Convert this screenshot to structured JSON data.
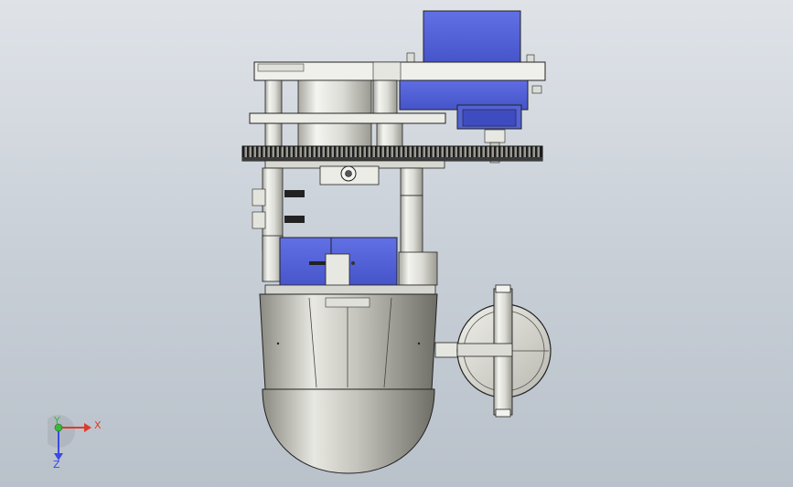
{
  "triad": {
    "x_label": "X",
    "y_label": "Y",
    "z_label": "Z"
  },
  "colors": {
    "background_top": "#dfe3e8",
    "background_bottom": "#b9c1ca",
    "motor_blue": "#5a68d8",
    "metal_light": "#eeeeea",
    "metal_mid": "#c9c9c1",
    "metal_dark": "#8d8d85",
    "gear_dark": "#2a2a2a",
    "axis_x": "#e03a2a",
    "axis_y": "#3ab83a",
    "axis_z": "#3a4ae0"
  },
  "model": {
    "parts": [
      "top-servo-motor",
      "top-plate",
      "standoff-columns",
      "middle-plate",
      "spur-gear",
      "bearing-block",
      "side-bracket",
      "vertical-arm",
      "pan-servo-motor",
      "cylindrical-body",
      "dome-base",
      "side-wheel"
    ]
  }
}
